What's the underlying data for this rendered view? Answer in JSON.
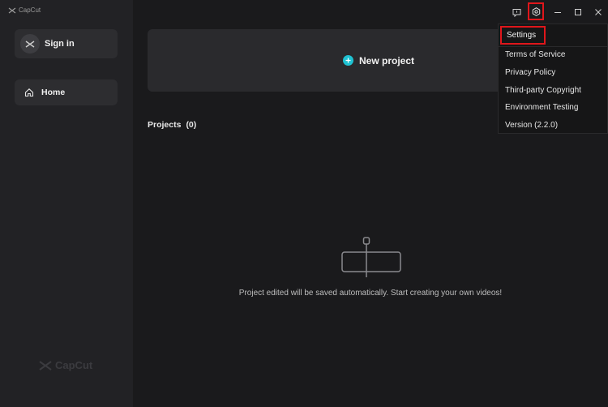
{
  "app": {
    "title": "CapCut"
  },
  "sidebar": {
    "sign_in_label": "Sign in",
    "home_label": "Home",
    "logo_text": "CapCut"
  },
  "main": {
    "new_project_label": "New project",
    "projects_label": "Projects",
    "projects_count": "(0)",
    "empty_message": "Project edited will be saved automatically. Start creating your own videos!"
  },
  "menu": {
    "items": [
      "Settings",
      "Terms of Service",
      "Privacy Policy",
      "Third-party Copyright",
      "Environment Testing",
      "Version (2.2.0)"
    ]
  },
  "colors": {
    "accent": "#1fc2d2",
    "highlight": "#e0161b",
    "background": "#1a1a1c",
    "sidebar": "#222225"
  }
}
